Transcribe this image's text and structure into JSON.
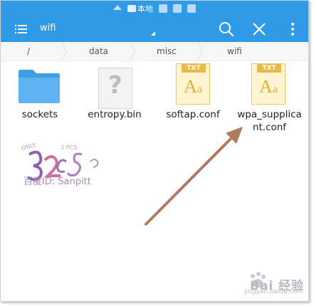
{
  "statusbar": {
    "location_label": "本地",
    "icons": [
      "home-icon",
      "message-icon",
      "image-icon",
      "print-icon",
      "phone-icon"
    ]
  },
  "toolbar": {
    "title": "wifi",
    "icons": [
      "menu-icon",
      "search-icon",
      "close-icon",
      "more-vertical-icon"
    ],
    "accent_color": "#2f9ae6"
  },
  "breadcrumb": {
    "items": [
      "/",
      "data",
      "misc",
      "wifi"
    ]
  },
  "files": [
    {
      "name": "sockets",
      "type": "folder"
    },
    {
      "name": "entropy.bin",
      "type": "unknown"
    },
    {
      "name": "softap.conf",
      "type": "txt"
    },
    {
      "name_line1": "wpa_supplica",
      "name_line2": "nt.conf",
      "type": "txt"
    }
  ],
  "txt_badge": "TXT",
  "txt_glyph_big": "A",
  "txt_glyph_small": "a",
  "unknown_glyph": "?",
  "watermark": {
    "caption": "百度ID: Sanpitt"
  },
  "baidu_watermark": {
    "text": "Bai 经验",
    "sub": "jingyan.baidu.com"
  },
  "arrow_color": "#b07a5c"
}
